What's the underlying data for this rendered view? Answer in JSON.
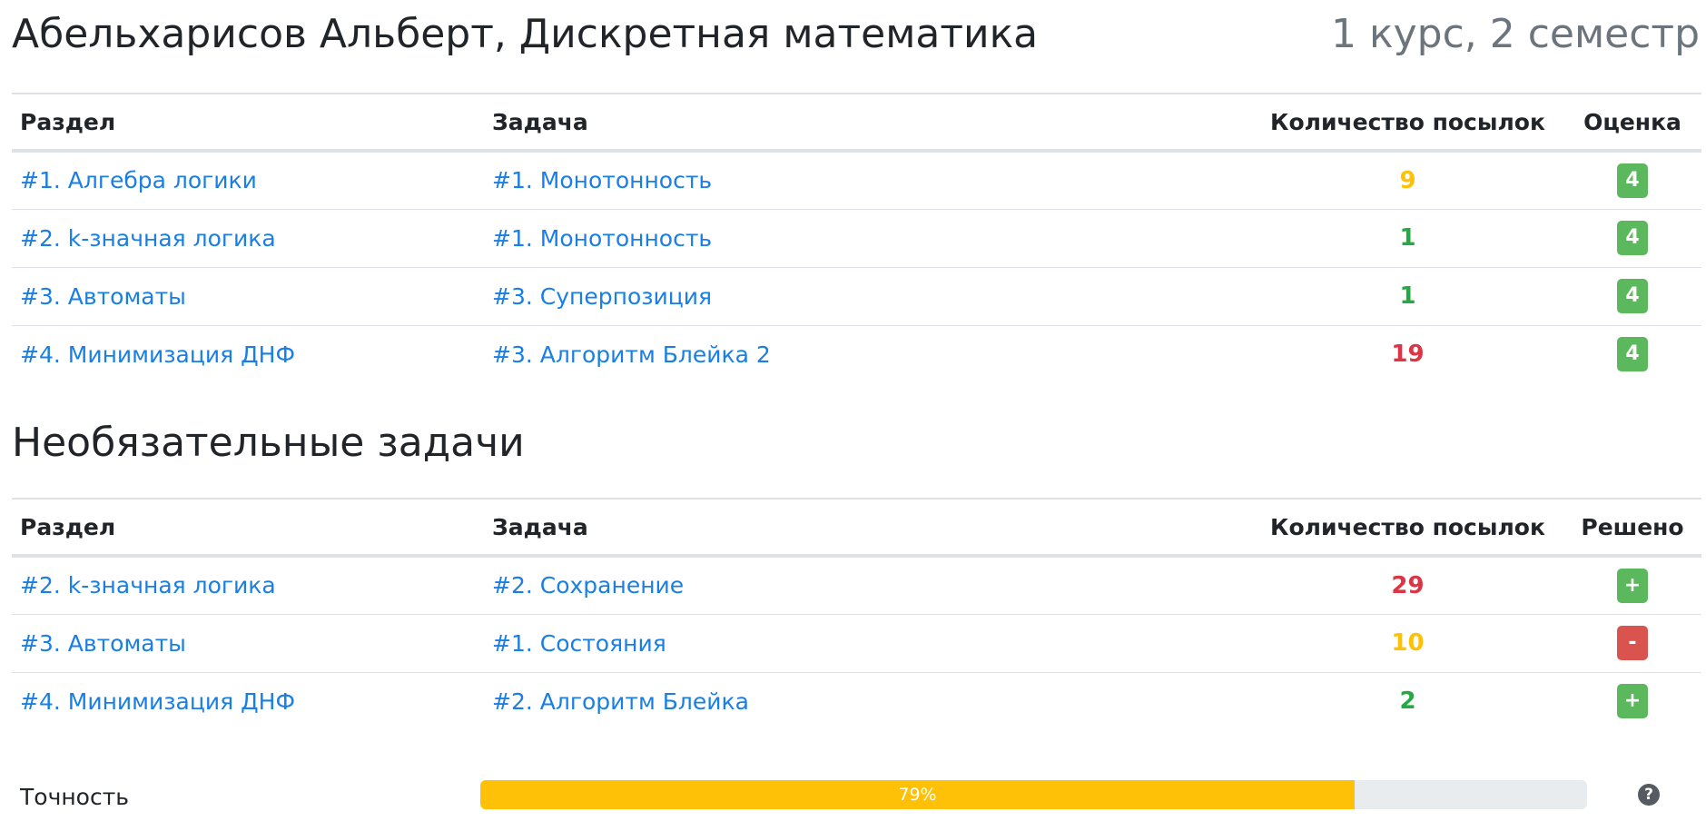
{
  "colors": {
    "link": "#1a7fe4",
    "success": "#28a745",
    "warning": "#ffc107",
    "danger": "#dc3545",
    "badge_success": "#5cb85c",
    "badge_danger": "#d9534f",
    "muted": "#6c757d"
  },
  "header": {
    "title": "Абельхарисов Альберт, Дискретная математика",
    "subtitle": "1 курс, 2 семестр"
  },
  "required": {
    "columns": {
      "section": "Раздел",
      "task": "Задача",
      "count": "Количество посылок",
      "mark": "Оценка"
    },
    "rows": [
      {
        "section": "#1. Алгебра логики",
        "task": "#1. Монотонность",
        "count": "9",
        "count_color": "#ffc107",
        "mark": "4",
        "mark_color": "#5cb85c"
      },
      {
        "section": "#2. k-значная логика",
        "task": "#1. Монотонность",
        "count": "1",
        "count_color": "#28a745",
        "mark": "4",
        "mark_color": "#5cb85c"
      },
      {
        "section": "#3. Автоматы",
        "task": "#3. Суперпозиция",
        "count": "1",
        "count_color": "#28a745",
        "mark": "4",
        "mark_color": "#5cb85c"
      },
      {
        "section": "#4. Минимизация ДНФ",
        "task": "#3. Алгоритм Блейка 2",
        "count": "19",
        "count_color": "#dc3545",
        "mark": "4",
        "mark_color": "#5cb85c"
      }
    ]
  },
  "optional": {
    "title": "Необязательные задачи",
    "columns": {
      "section": "Раздел",
      "task": "Задача",
      "count": "Количество посылок",
      "solved": "Решено"
    },
    "rows": [
      {
        "section": "#2. k-значная логика",
        "task": "#2. Сохранение",
        "count": "29",
        "count_color": "#dc3545",
        "solved": "+",
        "solved_color": "#5cb85c"
      },
      {
        "section": "#3. Автоматы",
        "task": "#1. Состояния",
        "count": "10",
        "count_color": "#ffc107",
        "solved": "-",
        "solved_color": "#d9534f"
      },
      {
        "section": "#4. Минимизация ДНФ",
        "task": "#2. Алгоритм Блейка",
        "count": "2",
        "count_color": "#28a745",
        "solved": "+",
        "solved_color": "#5cb85c"
      }
    ]
  },
  "accuracy": {
    "label": "Точность",
    "value": 79,
    "value_label": "79%",
    "help_icon": "question-circle-icon"
  }
}
